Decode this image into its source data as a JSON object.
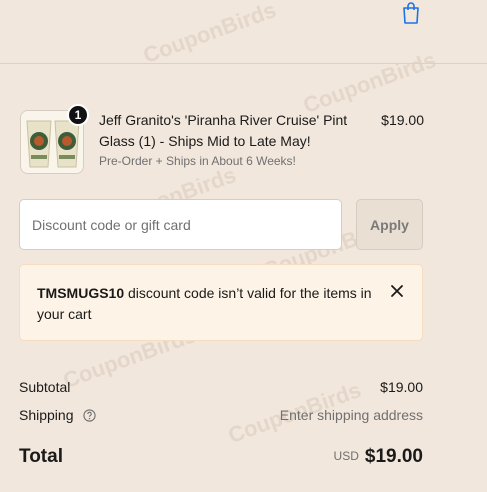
{
  "header": {
    "bag_icon": "shopping-bag-icon"
  },
  "cart_item": {
    "quantity": "1",
    "title": "Jeff Granito's 'Piranha River Cruise' Pint Glass (1) - Ships Mid to Late May!",
    "subtitle": "Pre-Order + Ships in About 6 Weeks!",
    "price": "$19.00"
  },
  "discount": {
    "placeholder": "Discount code or gift card",
    "apply_label": "Apply"
  },
  "error": {
    "code": "TMSMUGS10",
    "message": " discount code isn’t valid for the items in your cart"
  },
  "summary": {
    "subtotal_label": "Subtotal",
    "subtotal_value": "$19.00",
    "shipping_label": "Shipping",
    "shipping_value": "Enter shipping address",
    "total_label": "Total",
    "currency": "USD",
    "total_value": "$19.00"
  },
  "watermark": "CouponBirds",
  "colors": {
    "background": "#f2e7dc",
    "accent": "#1a73e8",
    "error_bg": "#fdf3e7"
  }
}
